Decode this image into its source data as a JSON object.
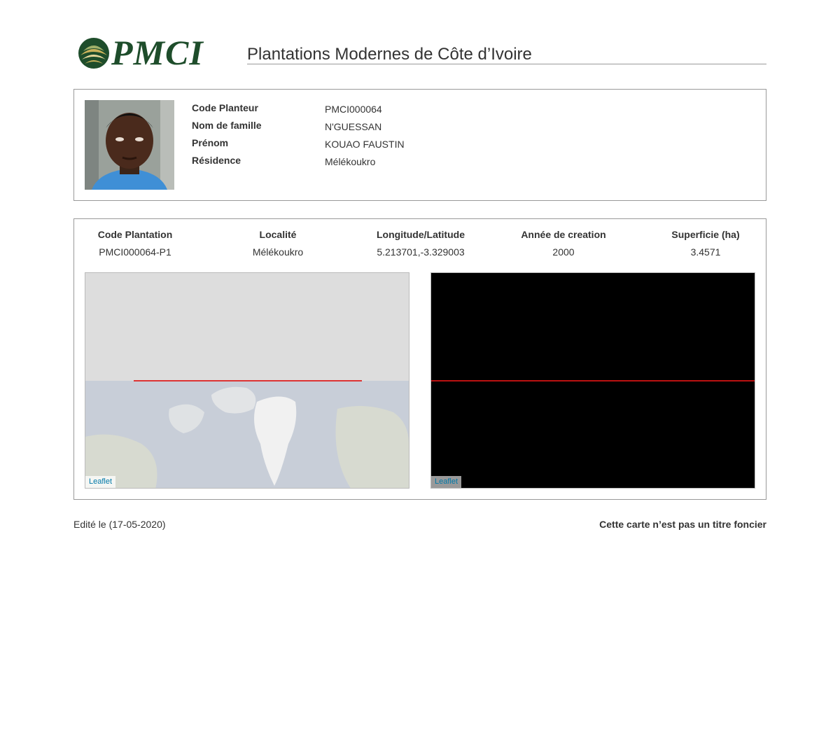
{
  "header": {
    "logo_text": "PMCI",
    "title": "Plantations Modernes de Côte d’Ivoire"
  },
  "planter": {
    "fields": [
      {
        "label": "Code Planteur",
        "value": "PMCI000064"
      },
      {
        "label": "Nom de famille",
        "value": "N'GUESSAN"
      },
      {
        "label": "Prénom",
        "value": "KOUAO FAUSTIN"
      },
      {
        "label": "Résidence",
        "value": "Mélékoukro"
      }
    ]
  },
  "plantation": {
    "columns": [
      {
        "header": "Code Plantation",
        "value": "PMCI000064-P1"
      },
      {
        "header": "Localité",
        "value": "Mélékoukro"
      },
      {
        "header": "Longitude/Latitude",
        "value": "5.213701,-3.329003"
      },
      {
        "header": "Année de creation",
        "value": "2000"
      },
      {
        "header": "Superficie (ha)",
        "value": "3.4571"
      }
    ]
  },
  "maps": {
    "left_attribution": "Leaflet",
    "right_attribution": "Leaflet"
  },
  "footer": {
    "edit_date": "Edité le (17-05-2020)",
    "disclaimer": "Cette carte n’est pas un titre foncier"
  },
  "colors": {
    "logo_green": "#1e4d2b",
    "map_line": "#dd3333",
    "link_blue": "#0078a8"
  }
}
